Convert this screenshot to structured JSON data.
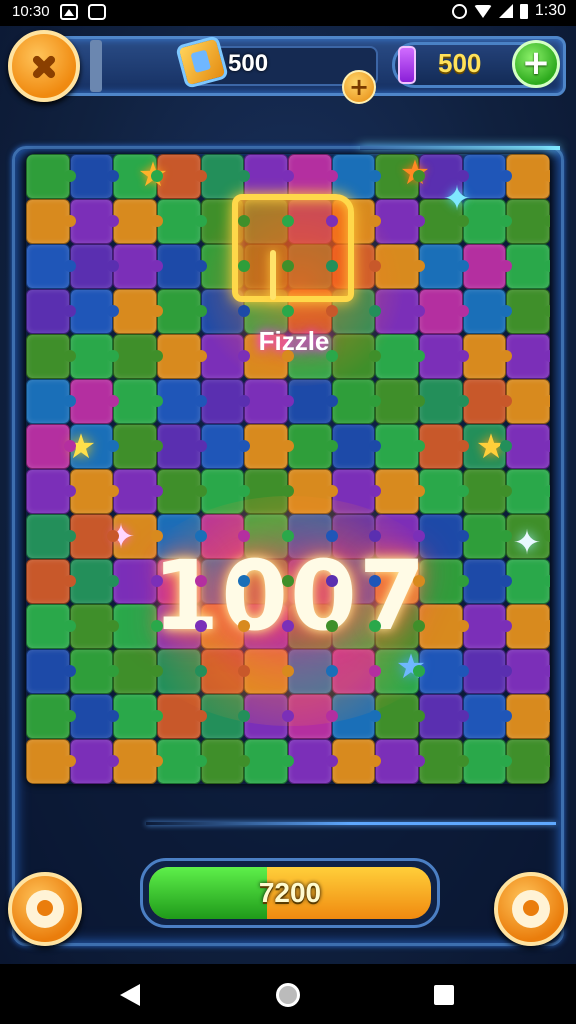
{
  "status_bar": {
    "left_text": "10:30",
    "right_text": "1:30"
  },
  "hud": {
    "coins": "500",
    "gems": "500"
  },
  "board": {
    "colors": [
      "#2f9e3a",
      "#7b2fb8",
      "#1f56b8",
      "#c8582a",
      "#3f8f2a",
      "#1d4aa8",
      "#b42fa0",
      "#d88a1e",
      "#238f5a",
      "#5a2fb0",
      "#2aa84a",
      "#1a6fb8"
    ],
    "logo_text": "Fizzle",
    "score_text": "1007"
  },
  "progress": {
    "label": "7200",
    "fraction": 0.42
  },
  "colors": {
    "accent_orange": "#f08a10",
    "accent_green": "#2eab1e",
    "frame_blue": "#3d6faf"
  }
}
